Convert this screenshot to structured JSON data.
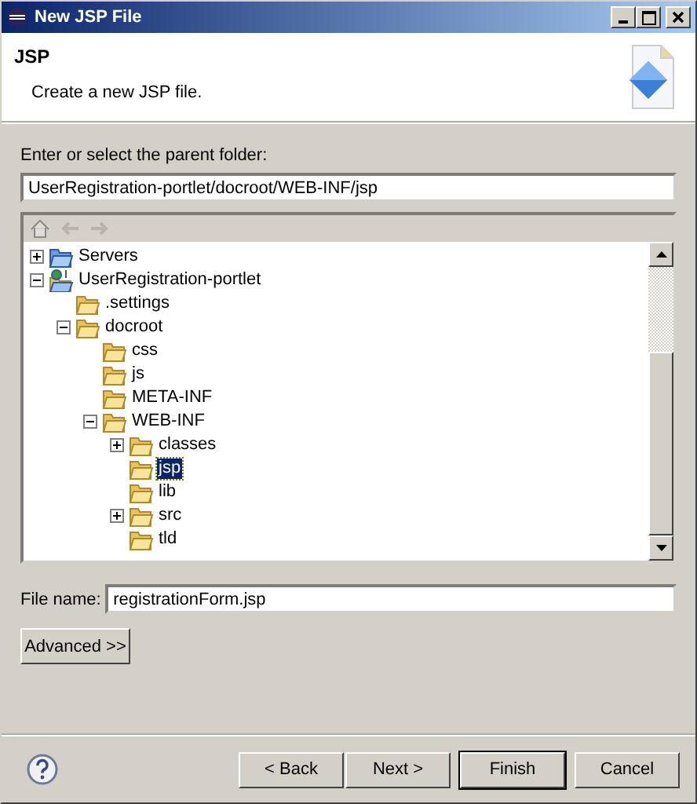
{
  "window": {
    "title": "New JSP File"
  },
  "header": {
    "title": "JSP",
    "description": "Create a new JSP file."
  },
  "parent_folder": {
    "label": "Enter or select the parent folder:",
    "value": "UserRegistration-portlet/docroot/WEB-INF/jsp"
  },
  "tree": [
    {
      "label": "Servers",
      "kind": "server-folder",
      "expanded": false,
      "selected": false
    },
    {
      "label": "UserRegistration-portlet",
      "kind": "project",
      "expanded": true,
      "selected": false,
      "children": [
        {
          "label": ".settings",
          "kind": "folder",
          "selected": false
        },
        {
          "label": "docroot",
          "kind": "folder",
          "expanded": true,
          "selected": false,
          "children": [
            {
              "label": "css",
              "kind": "folder",
              "selected": false
            },
            {
              "label": "js",
              "kind": "folder",
              "selected": false
            },
            {
              "label": "META-INF",
              "kind": "folder",
              "selected": false
            },
            {
              "label": "WEB-INF",
              "kind": "folder",
              "expanded": true,
              "selected": false,
              "children": [
                {
                  "label": "classes",
                  "kind": "folder",
                  "expanded": false,
                  "selected": false
                },
                {
                  "label": "jsp",
                  "kind": "folder",
                  "selected": true
                },
                {
                  "label": "lib",
                  "kind": "folder",
                  "selected": false
                },
                {
                  "label": "src",
                  "kind": "folder",
                  "expanded": false,
                  "selected": false
                },
                {
                  "label": "tld",
                  "kind": "folder",
                  "selected": false
                }
              ]
            }
          ]
        }
      ]
    }
  ],
  "file_name": {
    "label": "File name:",
    "value": "registrationForm.jsp"
  },
  "advanced_button": "Advanced >>",
  "buttons": [
    {
      "label": "< Back",
      "default": false
    },
    {
      "label": "Next >",
      "default": false
    },
    {
      "label": "Finish",
      "default": true
    },
    {
      "label": "Cancel",
      "default": false
    }
  ]
}
